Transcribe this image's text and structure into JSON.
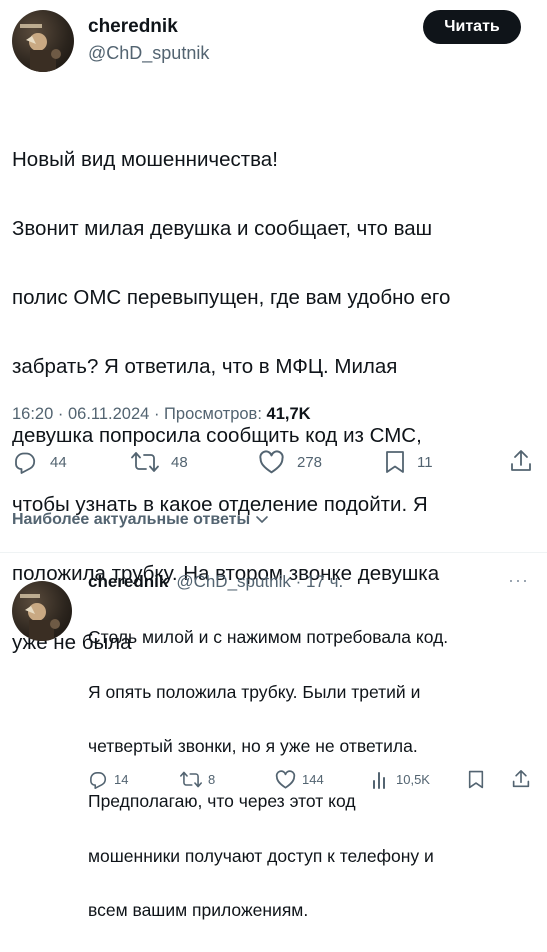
{
  "tweet": {
    "author": {
      "name": "cherednik",
      "handle": "@ChD_sputnik"
    },
    "follow_label": "Читать",
    "text_lines": [
      "Новый вид мошенничества!",
      "Звонит милая девушка и сообщает, что ваш",
      "полис ОМС перевыпущен, где вам удобно его",
      "забрать? Я ответила, что в МФЦ. Милая",
      "девушка попросила сообщить код из СМС,",
      "чтобы узнать в какое отделение подойти. Я",
      "положила трубку. На втором звонке девушка",
      "уже не была"
    ],
    "time": "16:20",
    "date": "06.11.2024",
    "views_label": "Просмотров:",
    "views": "41,7K",
    "meta_sep": "·",
    "counts": {
      "replies": "44",
      "reposts": "48",
      "likes": "278",
      "bookmarks": "11"
    }
  },
  "filter": {
    "label": "Наиболее актуальные ответы"
  },
  "reply": {
    "name": "cherednik",
    "handle": "@ChD_sputnik",
    "time": "17 ч.",
    "sep": " · ",
    "more": "···",
    "text_lines": [
      "Столь милой и с нажимом потребовала код.",
      "Я опять положила трубку. Были третий и",
      "четвертый звонки, но я уже не ответила.",
      "Предполагаю, что через этот код",
      "мошенники получают доступ к телефону и",
      "всем вашим приложениям."
    ],
    "counts": {
      "replies": "14",
      "reposts": "8",
      "likes": "144",
      "views": "10,5K"
    }
  },
  "icons": [
    "reply-icon",
    "repost-icon",
    "like-icon",
    "bookmark-icon",
    "share-icon",
    "views-icon",
    "chevron-down-icon",
    "more-icon"
  ],
  "colors": {
    "text": "#0f1419",
    "secondary": "#536471",
    "button_bg": "#0f1419",
    "divider": "#eff3f4"
  }
}
